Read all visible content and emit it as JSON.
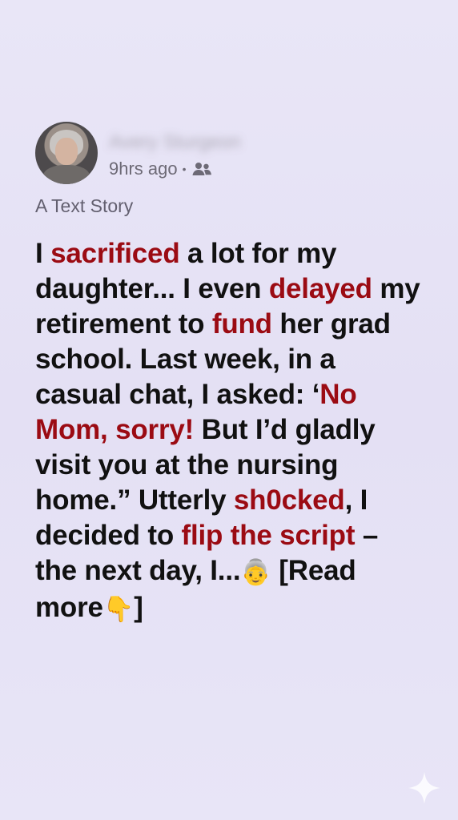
{
  "author": {
    "name": "Avery Sturgeon",
    "timestamp": "9hrs ago",
    "separator": "•",
    "audience_icon": "people-icon"
  },
  "story": {
    "subtitle": "A Text Story",
    "parts": {
      "p1": "I ",
      "h1": "sacrificed",
      "p2": " a lot for my daughter... I even ",
      "h2": "delayed",
      "p3": " my retirement to ",
      "h3": "fund",
      "p4": " her grad school. Last week, in a casual chat, I asked: ‘",
      "h4": "No Mom, sorry!",
      "p5": " But I’d gladly visit you at the nursing home.” Utterly ",
      "h5": "sh0cked",
      "p6": ", I decided to ",
      "h6": "flip the script",
      "p7": " – the next day, I...",
      "emoji1": "👵",
      "p8": " [Read more",
      "emoji2": "👇",
      "p9": "]"
    }
  },
  "icons": {
    "avatar": "older-woman-avatar",
    "watermark": "sparkle-icon"
  },
  "colors": {
    "highlight": "#9b0b13",
    "text": "#111111",
    "background": "#e6e2f5"
  }
}
